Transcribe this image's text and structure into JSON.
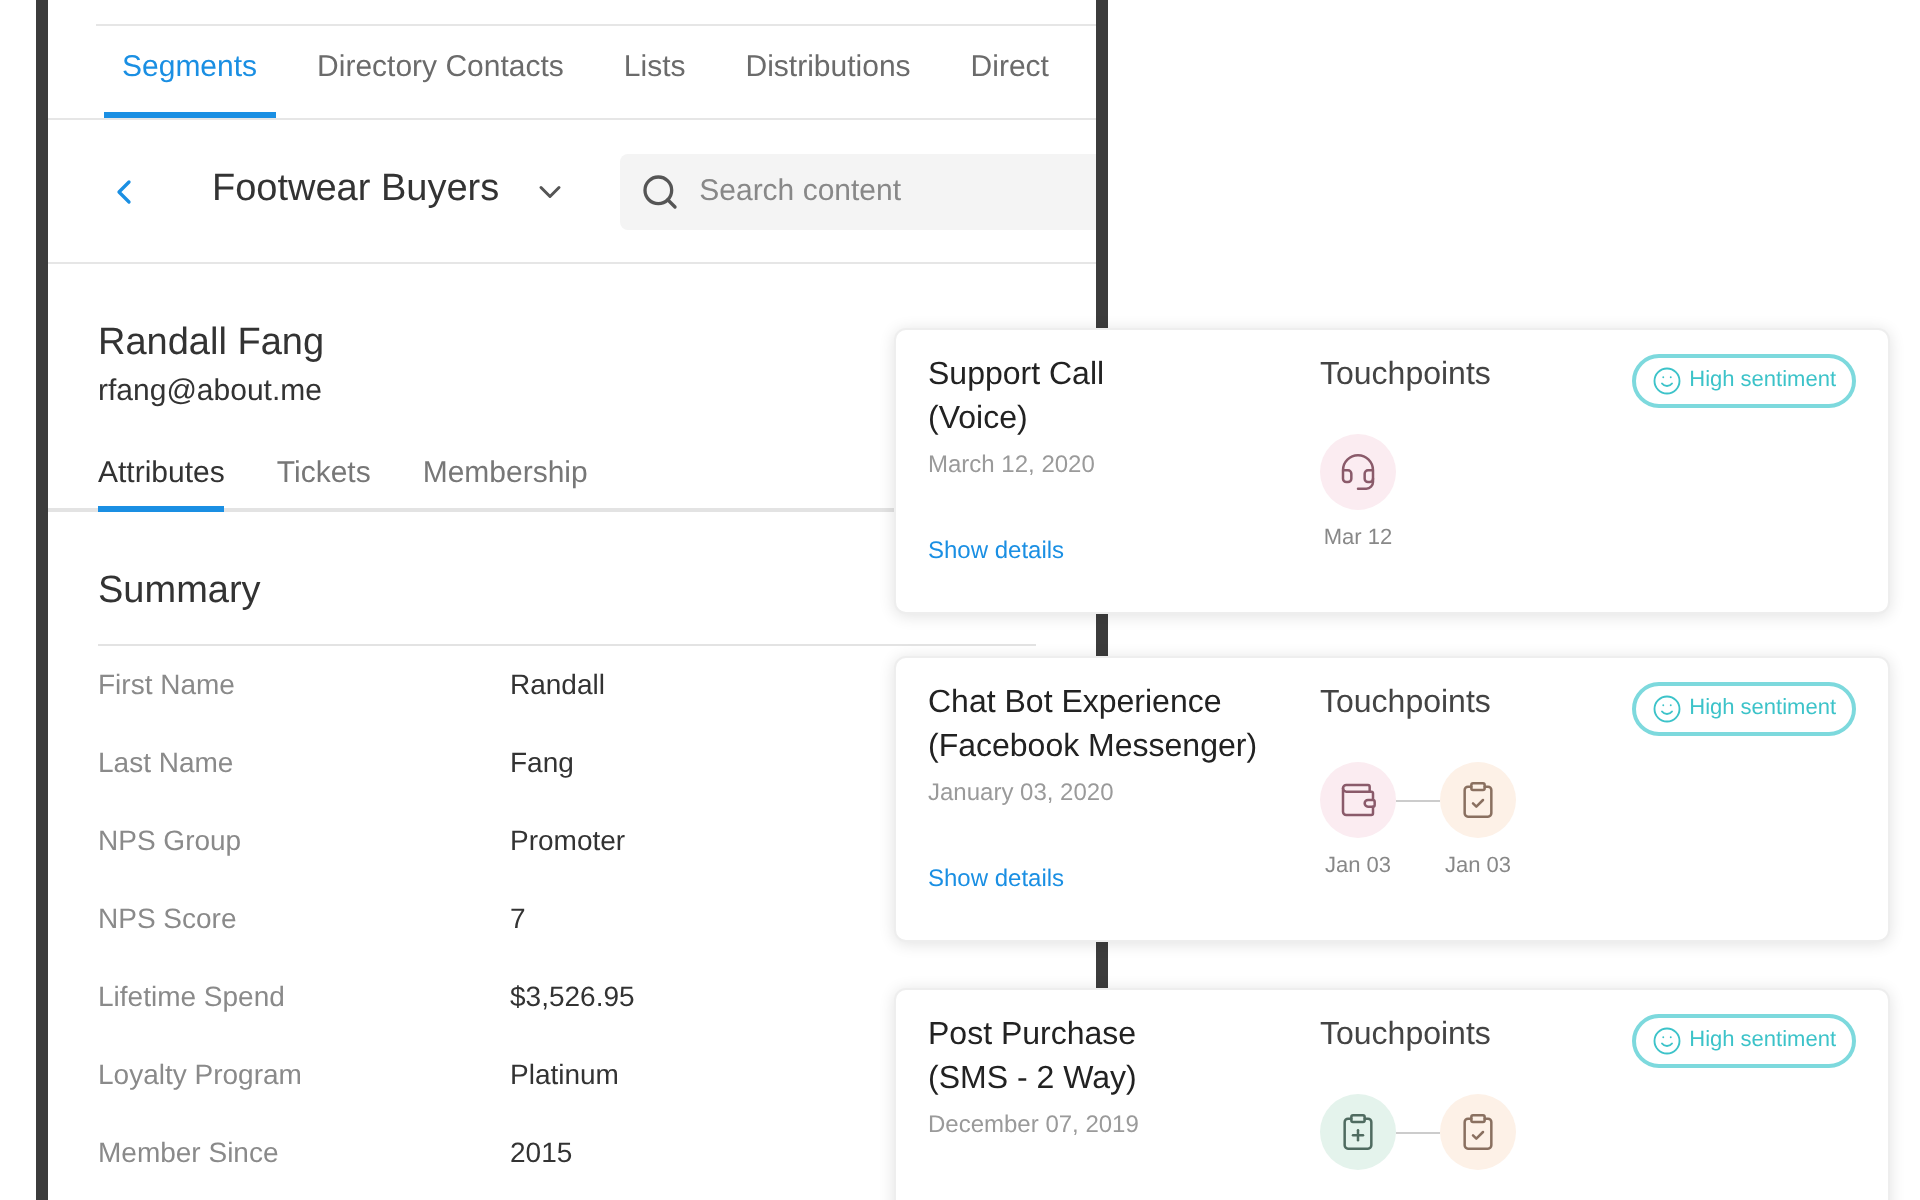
{
  "nav_tabs": [
    {
      "label": "Segments",
      "selected": true
    },
    {
      "label": "Directory Contacts",
      "selected": false
    },
    {
      "label": "Lists",
      "selected": false
    },
    {
      "label": "Distributions",
      "selected": false
    },
    {
      "label": "Direct",
      "selected": false
    }
  ],
  "header": {
    "title": "Footwear Buyers",
    "search": {
      "placeholder": "Search content"
    }
  },
  "contact": {
    "name": "Randall Fang",
    "email": "rfang@about.me"
  },
  "contact_tabs": [
    {
      "label": "Attributes",
      "selected": true
    },
    {
      "label": "Tickets",
      "selected": false
    },
    {
      "label": "Membership",
      "selected": false
    }
  ],
  "summary": {
    "title": "Summary",
    "rows": [
      {
        "label": "First Name",
        "value": "Randall"
      },
      {
        "label": "Last Name",
        "value": "Fang"
      },
      {
        "label": "NPS Group",
        "value": "Promoter"
      },
      {
        "label": "NPS Score",
        "value": "7"
      },
      {
        "label": "Lifetime Spend",
        "value": "$3,526.95"
      },
      {
        "label": "Loyalty Program",
        "value": "Platinum"
      },
      {
        "label": "Member Since",
        "value": "2015"
      }
    ]
  },
  "cards": [
    {
      "title": [
        "Support Call",
        "(Voice)"
      ],
      "date": "March 12, 2020",
      "link": "Show details",
      "touchpoints_label": "Touchpoints",
      "badge": "High sentiment",
      "touchpoints": [
        {
          "kind": "headset",
          "color": "#fbecf1",
          "date": "Mar 12"
        }
      ]
    },
    {
      "title": [
        "Chat Bot Experience",
        "(Facebook Messenger)"
      ],
      "date": "January 03, 2020",
      "link": "Show details",
      "touchpoints_label": "Touchpoints",
      "badge": "High sentiment",
      "touchpoints": [
        {
          "kind": "wallet",
          "color": "#fbecf1",
          "date": "Jan 03"
        },
        {
          "kind": "clipboard-check",
          "color": "#fdf1e7",
          "date": "Jan 03"
        }
      ]
    },
    {
      "title": [
        "Post Purchase",
        "(SMS - 2 Way)"
      ],
      "date": "December 07, 2019",
      "touchpoints_label": "Touchpoints",
      "badge": "High sentiment",
      "touchpoints": [
        {
          "kind": "clipboard-plus",
          "color": "#e4f3ec"
        },
        {
          "kind": "clipboard-check",
          "color": "#fdf1e7"
        }
      ]
    }
  ]
}
